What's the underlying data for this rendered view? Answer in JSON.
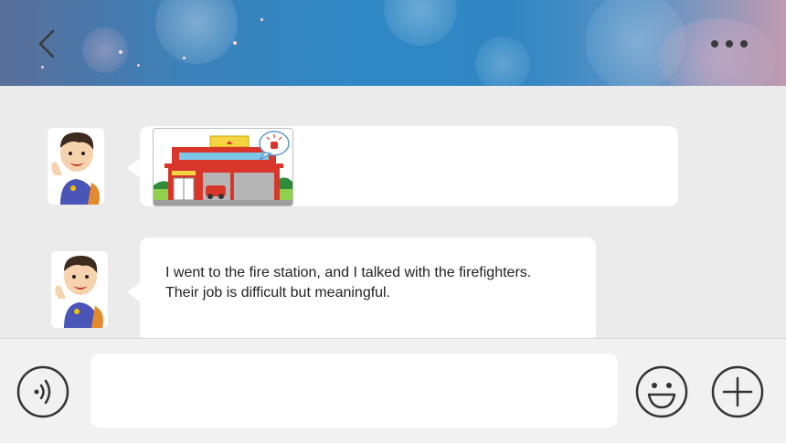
{
  "header": {
    "back_icon": "chevron-left-icon",
    "more_icon": "more-dots-icon"
  },
  "messages": [
    {
      "type": "image",
      "sender_avatar": "boy-avatar",
      "image_subject": "fire-station-illustration"
    },
    {
      "type": "text",
      "sender_avatar": "boy-avatar",
      "text": "I went to the fire station, and I talked with the firefighters.\nTheir job is difficult but meaningful."
    }
  ],
  "input_bar": {
    "voice_icon": "voice-icon",
    "input_value": "",
    "emoji_icon": "smiley-icon",
    "plus_icon": "plus-icon"
  },
  "colors": {
    "background": "#ebebeb",
    "header_blue": "#2f88c4",
    "bubble": "#ffffff",
    "icon": "#333333",
    "fire_station_red": "#d9362b"
  }
}
